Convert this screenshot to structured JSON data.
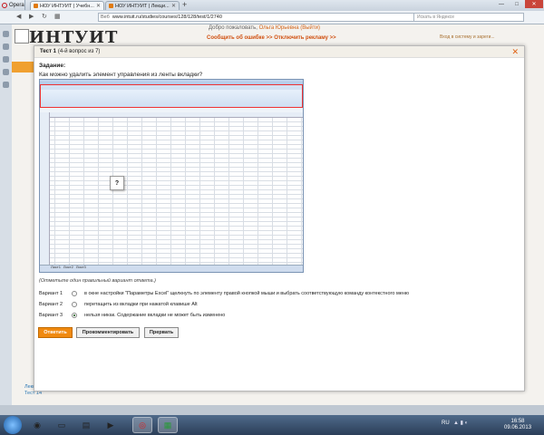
{
  "browser": {
    "menu_label": "Opera",
    "tabs": [
      {
        "label": "НОУ ИНТУИТ | Учебн...",
        "active": true
      },
      {
        "label": "НОУ ИНТУИТ | Лекци...",
        "active": false
      }
    ],
    "new_tab": "+",
    "address_prefix": "Веб",
    "url": "www.intuit.ru/studies/courses/128/128/test/1/2740",
    "search_placeholder": "Искать в Яндексе",
    "window_buttons": [
      "—",
      "□",
      "✕"
    ]
  },
  "site": {
    "logo": "ИНТУИТ",
    "greeting": "Добро пожаловать,",
    "user": "Ольга Юрьевна",
    "logout": "(Выйти)",
    "links": "Сообщить об ошибке >>   Отключить рекламу >>",
    "right_top": "Вход в систему и зареги...",
    "bottom_links": [
      "Лекция 14",
      "Тест 14"
    ]
  },
  "modal": {
    "title_bold": "Тест 1",
    "title_rest": "(4-й вопрос из 7)",
    "close": "✕",
    "task_label": "Задание:",
    "question": "Как можно удалить элемент управления из ленты вкладки?",
    "qmark": "?",
    "hint": "(Отметьте один правильный вариант ответа.)",
    "options": [
      {
        "label": "Вариант 1",
        "text": "в окне настройки \"Параметры Excel\" щелкнуть по элементу правой кнопкой мыши и выбрать соответствующую команду контекстного меню",
        "checked": false
      },
      {
        "label": "Вариант 2",
        "text": "перетащить из вкладки при нажатой клавише Alt",
        "checked": false
      },
      {
        "label": "Вариант 3",
        "text": "нельзя никак. Содержание вкладки не может быть изменено",
        "checked": true
      }
    ],
    "buttons": {
      "answer": "Ответить",
      "comment": "Прокомментировать",
      "skip": "Прервать"
    }
  },
  "excel": {
    "sheet_tabs": [
      "Лист1",
      "Лист2",
      "Лист3"
    ]
  },
  "taskbar": {
    "lang": "RU",
    "time": "16:58",
    "date": "09.06.2013"
  }
}
